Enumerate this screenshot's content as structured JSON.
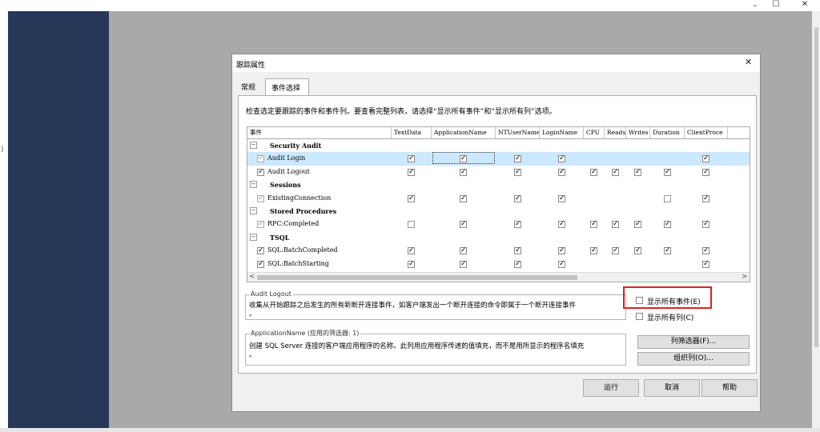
{
  "window_controls": {
    "minimize": "–",
    "maximize": "☐",
    "close": "✕"
  },
  "left_edge_char": ")",
  "dialog": {
    "title": "跟踪属性",
    "close": "✕",
    "tabs": [
      {
        "label": "常规"
      },
      {
        "label": "事件选择"
      }
    ],
    "instruction": "检查选定要跟踪的事件和事件列。要查看完整列表，请选择“显示所有事件”和“显示所有列”选项。",
    "grid": {
      "header_first": "事件",
      "columns": [
        "TextData",
        "ApplicationName",
        "NTUserName",
        "LoginName",
        "CPU",
        "Reads",
        "Writes",
        "Duration",
        "ClientProce"
      ],
      "groups": [
        {
          "name": "Security Audit",
          "expander": "−",
          "events": [
            {
              "name": "Audit Login",
              "selected": true,
              "check": "gray",
              "cells": [
                "c",
                "c",
                "c",
                "c",
                "",
                "",
                "",
                "",
                "c"
              ]
            },
            {
              "name": "Audit Logout",
              "selected": false,
              "check": "on",
              "cells": [
                "c",
                "c",
                "c",
                "c",
                "c",
                "c",
                "c",
                "c",
                "c"
              ]
            }
          ]
        },
        {
          "name": "Sessions",
          "expander": "−",
          "events": [
            {
              "name": "ExistingConnection",
              "selected": false,
              "check": "gray",
              "cells": [
                "c",
                "c",
                "c",
                "c",
                "",
                "",
                "",
                "u",
                "c"
              ]
            }
          ]
        },
        {
          "name": "Stored Procedures",
          "expander": "−",
          "events": [
            {
              "name": "RPC:Completed",
              "selected": false,
              "check": "gray",
              "cells": [
                "u",
                "c",
                "c",
                "c",
                "c",
                "c",
                "c",
                "c",
                "c"
              ]
            }
          ]
        },
        {
          "name": "TSQL",
          "expander": "−",
          "events": [
            {
              "name": "SQL:BatchCompleted",
              "selected": false,
              "check": "on",
              "cells": [
                "c",
                "c",
                "c",
                "c",
                "c",
                "c",
                "c",
                "c",
                "c"
              ]
            },
            {
              "name": "SQL:BatchStarting",
              "selected": false,
              "check": "on",
              "cells": [
                "c",
                "c",
                "c",
                "c",
                "",
                "",
                "",
                "",
                "c"
              ]
            }
          ]
        }
      ],
      "scroll_left": "<",
      "scroll_right": ">"
    },
    "event_desc": {
      "label": "Audit Logout",
      "text": "收集从开始跟踪之后发生的所有新断开连接事件，如客户端发出一个断开连接的命令即属于一个断开连接事件",
      "text2": "。"
    },
    "column_desc": {
      "label": "ApplicationName (应用的筛选器: 1)",
      "text": "创建 SQL Server 连接的客户端应用程序的名称。此列用应用程序传递的值填充，而不是用所显示的程序名填充",
      "text2": "。"
    },
    "show_all_events": {
      "label": "显示所有事件(E)",
      "checked": false
    },
    "show_all_columns": {
      "label": "显示所有列(C)",
      "checked": false
    },
    "column_filter_button": "列筛选器(F)...",
    "organize_columns_button": "组织列(O)...",
    "run_button": "运行",
    "cancel_button": "取消",
    "help_button": "帮助"
  },
  "colors": {
    "sidebar": "#253858",
    "backdrop": "#a9a9a9",
    "selection": "#cce8ff",
    "highlight_box": "#e02020"
  }
}
